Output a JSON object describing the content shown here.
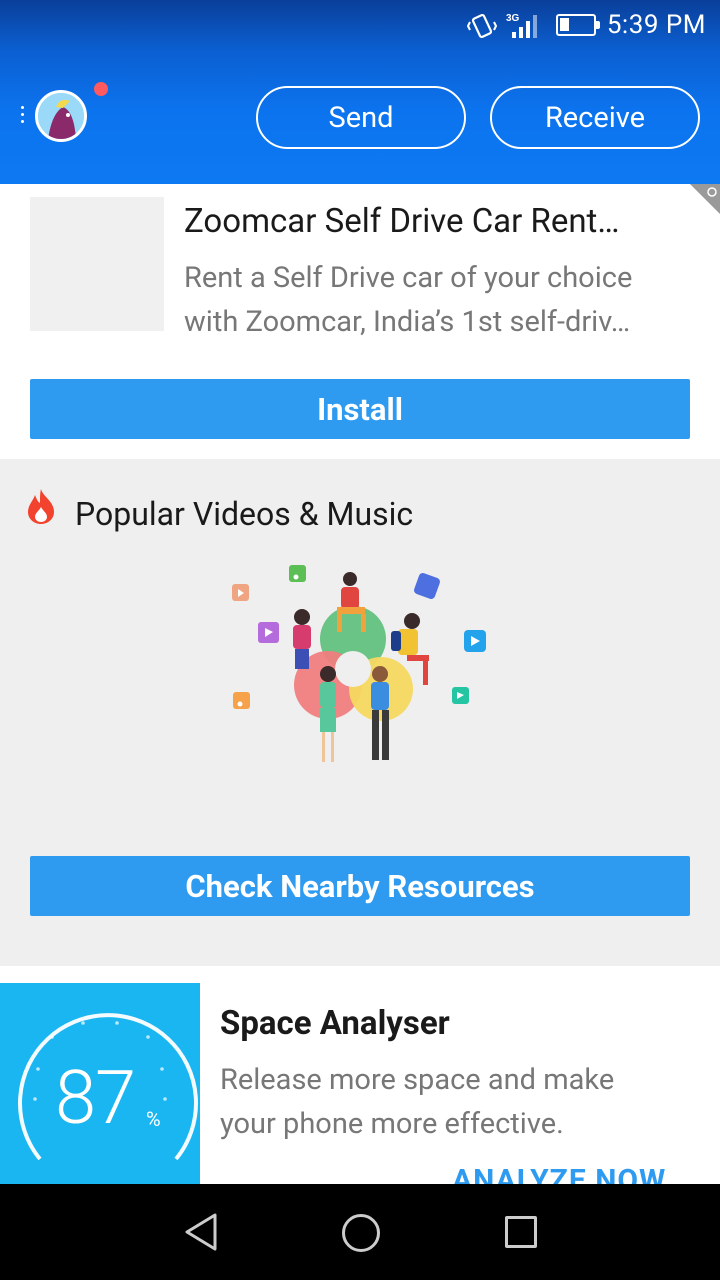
{
  "status_bar": {
    "network": "3G",
    "time": "5:39 PM",
    "battery_level": 0.25
  },
  "header": {
    "send_label": "Send",
    "receive_label": "Receive",
    "has_notification": true
  },
  "ad": {
    "title": "Zoomcar Self Drive Car Rent…",
    "description_line1": "Rent a Self Drive car of your choice",
    "description_line2": "with Zoomcar, India’s 1st self-driv…",
    "install_label": "Install"
  },
  "popular": {
    "title": "Popular Videos & Music",
    "button_label": "Check Nearby Resources"
  },
  "space_analyser": {
    "percent": "87",
    "percent_sign": "%",
    "title": "Space Analyser",
    "description_line1": "Release more space and make",
    "description_line2": "your phone more effective.",
    "action_label": "ANALYZE NOW"
  },
  "colors": {
    "header_blue": "#0d79f3",
    "button_blue": "#2e9bf0",
    "gauge_blue": "#1ab6f2",
    "notification_red": "#ff5a5f"
  },
  "icons": [
    "vibrate-icon",
    "signal-icon",
    "battery-icon",
    "menu-icon",
    "fire-icon",
    "back-icon",
    "home-icon",
    "recents-icon"
  ]
}
